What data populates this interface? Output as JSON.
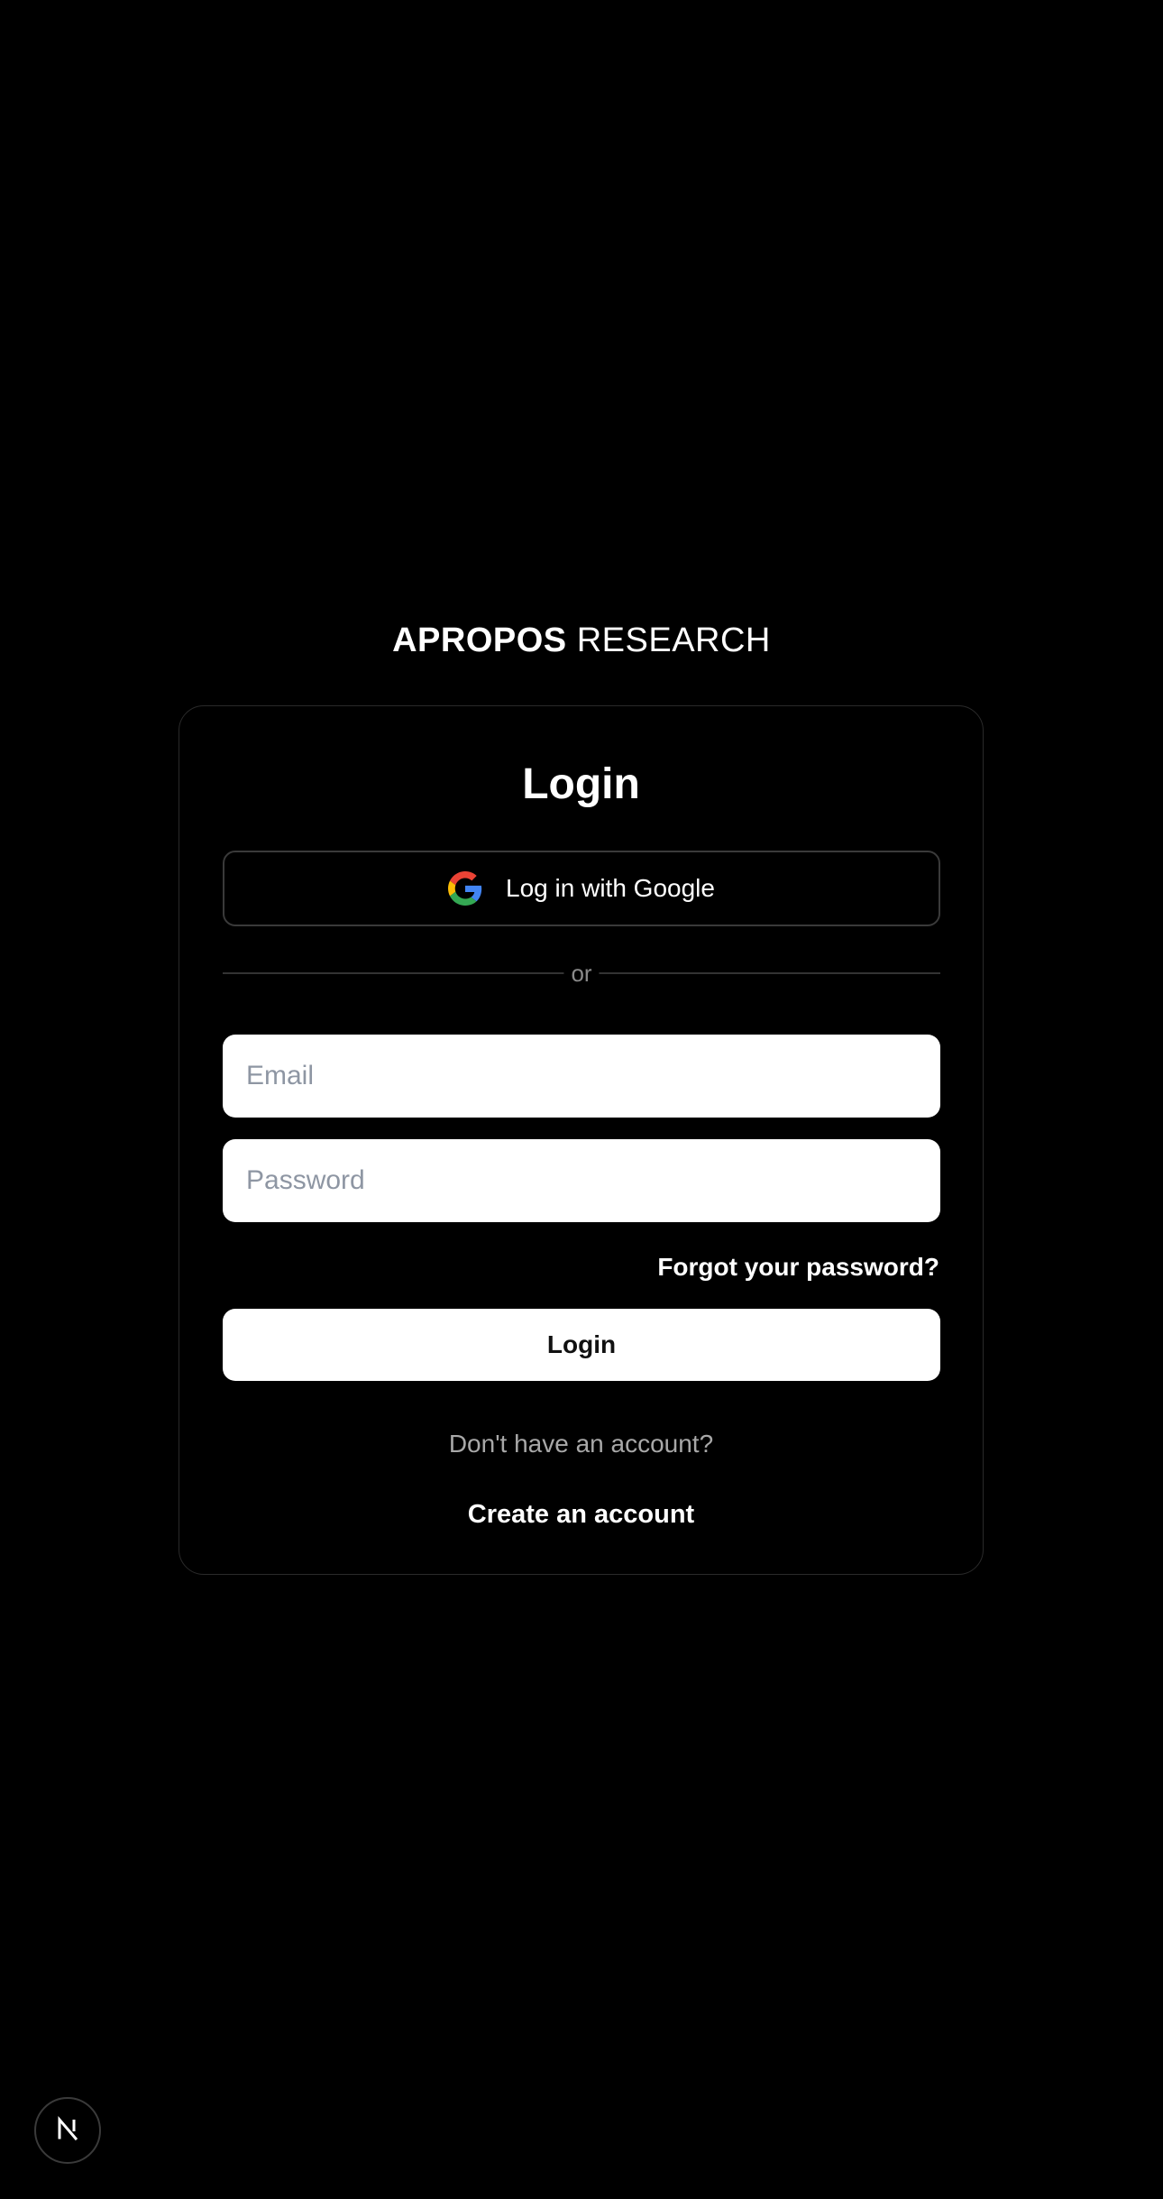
{
  "brand": {
    "bold": "APROPOS",
    "light": "RESEARCH"
  },
  "login_card": {
    "title": "Login",
    "google_button_label": "Log in with Google",
    "google_icon": "google-g-icon",
    "divider_text": "or",
    "email_placeholder": "Email",
    "password_placeholder": "Password",
    "forgot_password": "Forgot your password?",
    "login_button": "Login",
    "no_account_text": "Don't have an account?",
    "create_account_link": "Create an account"
  },
  "dev_badge": {
    "icon": "nextjs-n-icon",
    "label": "N"
  },
  "colors": {
    "background": "#000000",
    "card_border": "#2a2a2a",
    "text_primary": "#ffffff",
    "text_muted": "#a8a8a8",
    "button_bg": "#ffffff",
    "button_text": "#111111",
    "placeholder": "#8e96a3"
  }
}
